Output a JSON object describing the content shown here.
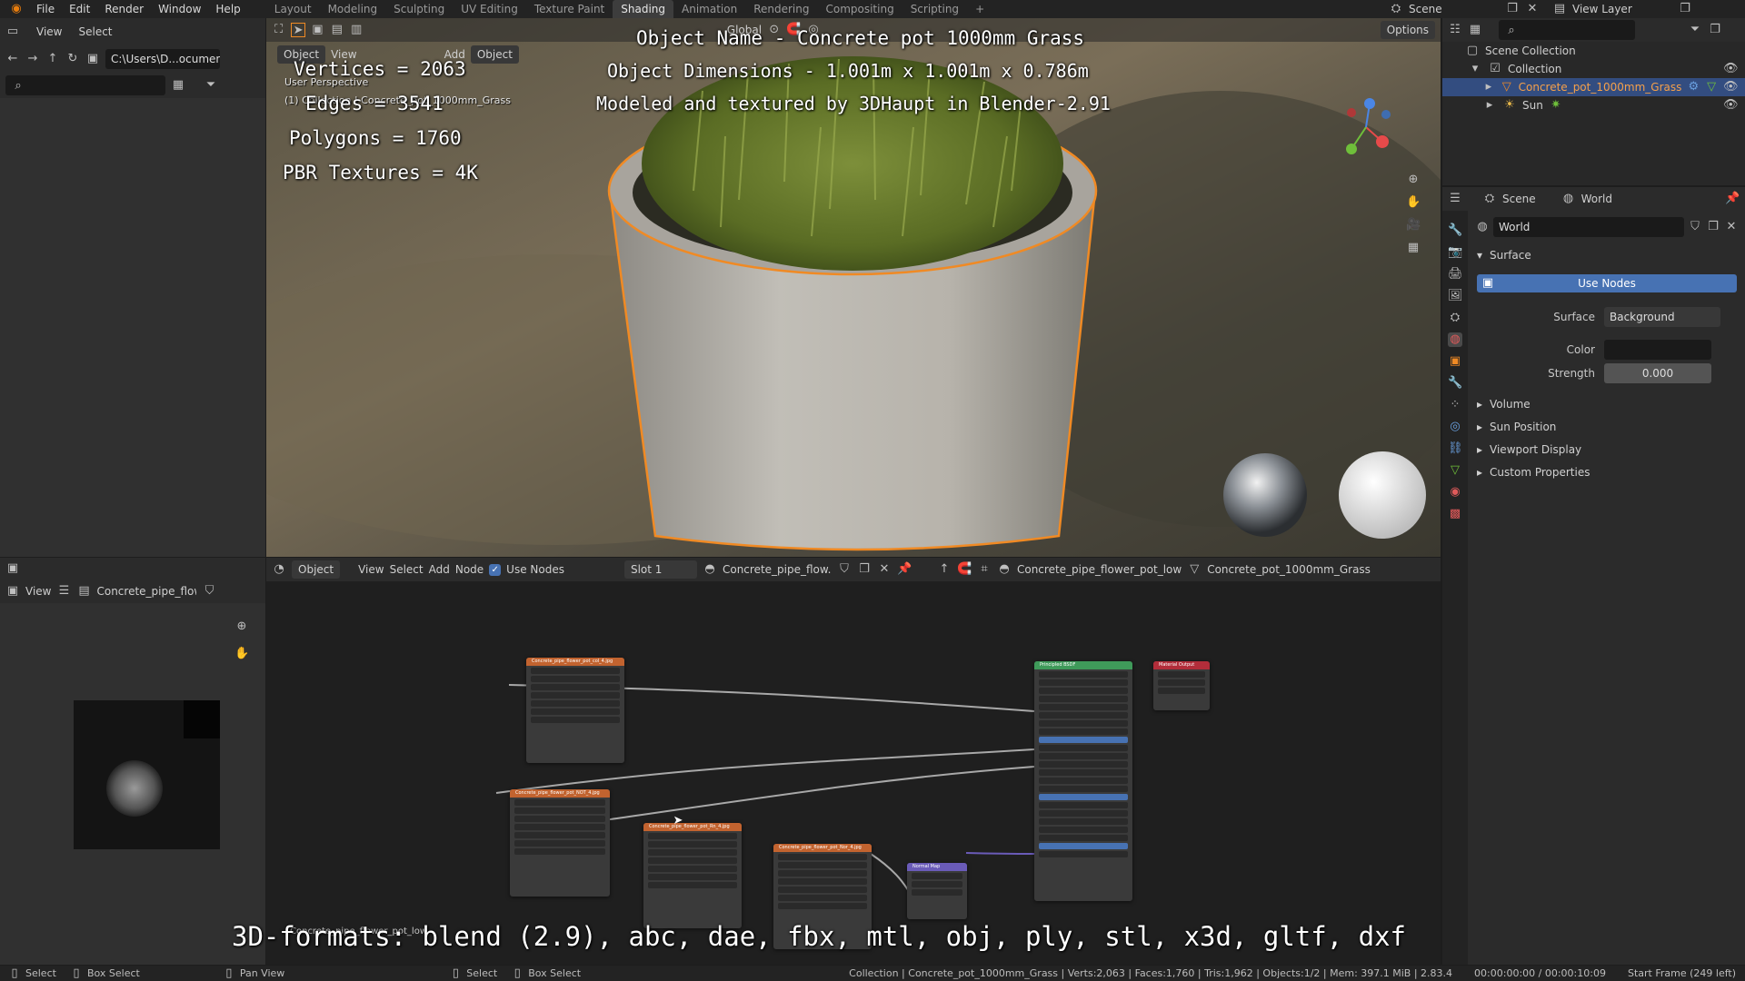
{
  "topbar": {
    "menus": [
      "File",
      "Edit",
      "Render",
      "Window",
      "Help"
    ],
    "workspaces": [
      "Layout",
      "Modeling",
      "Sculpting",
      "UV Editing",
      "Texture Paint",
      "Shading",
      "Animation",
      "Rendering",
      "Compositing",
      "Scripting"
    ],
    "active_workspace": "Shading",
    "scene_label": "Scene",
    "view_layer_label": "View Layer"
  },
  "file_browser": {
    "view_label": "View",
    "select_label": "Select",
    "path": "C:\\Users\\D...ocuments\\"
  },
  "viewport": {
    "mode_label": "Object",
    "view_label": "View",
    "add_label": "Add",
    "object_label": "Object",
    "transform_label": "Global",
    "options_label": "Options",
    "persp_label": "User Perspective",
    "collection_label": "(1) Collection | Concrete_pot_1000mm_Grass"
  },
  "overlay": {
    "object_name": "Object Name - Concrete pot 1000mm Grass",
    "dimensions": "Object Dimensions -  1.001m x 1.001m x 0.786m",
    "credits": "Modeled and textured by 3DHaupt in Blender-2.91",
    "vertices": "Vertices = 2063",
    "edges": "Edges = 3541",
    "polygons": "Polygons = 1760",
    "textures": "PBR Textures = 4K",
    "formats": "3D-formats: blend (2.9), abc, dae, fbx, mtl, obj, ply, stl, x3d, gltf, dxf"
  },
  "image_editor": {
    "view_label": "View",
    "image_name": "Concrete_pipe_flow..."
  },
  "node_editor": {
    "object_label": "Object",
    "view_label": "View",
    "select_label": "Select",
    "add_label": "Add",
    "node_label": "Node",
    "use_nodes_label": "Use Nodes",
    "slot_label": "Slot 1",
    "material_name": "Concrete_pipe_flow...",
    "breadcrumb_material": "Concrete_pipe_flower_pot_low",
    "breadcrumb_object": "Concrete_pot_1000mm_Grass",
    "frame_label": "Concrete_pipe_flower_pot_low",
    "nodes": [
      {
        "id": "tex1",
        "title": "Concrete_pipe_flower_pot_col_4.jpg",
        "color": "#c2632f"
      },
      {
        "id": "tex2",
        "title": "Concrete_pipe_flower_pot_NOT_4.jpg",
        "color": "#c2632f"
      },
      {
        "id": "tex3",
        "title": "Concrete_pipe_flower_pot_Rn_4.jpg",
        "color": "#c2632f"
      },
      {
        "id": "tex4",
        "title": "Concrete_pipe_flower_pot_Nor_4.jpg",
        "color": "#c2632f"
      },
      {
        "id": "normal",
        "title": "Normal Map",
        "color": "#6a5bb8"
      },
      {
        "id": "bsdf",
        "title": "Principled BSDF",
        "color": "#3f9a5a"
      },
      {
        "id": "output",
        "title": "Material Output",
        "color": "#b22d3a"
      }
    ]
  },
  "outliner": {
    "scene_collection": "Scene Collection",
    "collection": "Collection",
    "object": "Concrete_pot_1000mm_Grass",
    "sun": "Sun"
  },
  "properties": {
    "scene_tab": "Scene",
    "world_tab": "World",
    "world_name": "World",
    "surface_section": "Surface",
    "use_nodes_button": "Use Nodes",
    "surface_label": "Surface",
    "surface_value": "Background",
    "color_label": "Color",
    "strength_label": "Strength",
    "strength_value": "0.000",
    "sections": [
      "Volume",
      "Sun Position",
      "Viewport Display",
      "Custom Properties"
    ]
  },
  "statusbar": {
    "select": "Select",
    "box_select": "Box Select",
    "pan_view": "Pan View",
    "select2": "Select",
    "box_select2": "Box Select",
    "stats": "Collection | Concrete_pot_1000mm_Grass | Verts:2,063 | Faces:1,760 | Tris:1,962 | Objects:1/2 | Mem: 397.1 MiB | 2.83.4",
    "time": "00:00:00:00 / 00:00:10:09",
    "start_frame": "Start Frame (249 left)"
  },
  "colors": {
    "accent": "#4772b3",
    "selection": "#f08a24",
    "bg": "#1d1d1d"
  }
}
